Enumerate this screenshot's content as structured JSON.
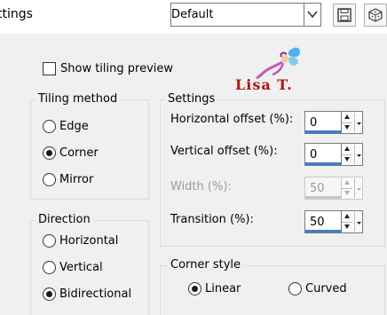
{
  "window": {
    "title": "ttings"
  },
  "preset": {
    "value": "Default"
  },
  "toolbar": {
    "save_icon": "save-icon",
    "random_icon": "dice-icon"
  },
  "show_tiling_preview": {
    "label": "Show tiling preview",
    "checked": false
  },
  "tiling_method": {
    "title": "Tiling method",
    "options": [
      {
        "label": "Edge",
        "checked": false
      },
      {
        "label": "Corner",
        "checked": true
      },
      {
        "label": "Mirror",
        "checked": false
      }
    ]
  },
  "direction": {
    "title": "Direction",
    "options": [
      {
        "label": "Horizontal",
        "checked": false
      },
      {
        "label": "Vertical",
        "checked": false
      },
      {
        "label": "Bidirectional",
        "checked": true
      }
    ]
  },
  "settings": {
    "title": "Settings",
    "horizontal_offset": {
      "label": "Horizontal offset (%):",
      "value": "0",
      "enabled": true
    },
    "vertical_offset": {
      "label": "Vertical offset (%):",
      "value": "0",
      "enabled": true
    },
    "width": {
      "label": "Width (%):",
      "value": "50",
      "enabled": false
    },
    "transition": {
      "label": "Transition (%):",
      "value": "50",
      "enabled": true
    }
  },
  "corner_style": {
    "title": "Corner style",
    "options": [
      {
        "label": "Linear",
        "checked": true
      },
      {
        "label": "Curved",
        "checked": false
      }
    ]
  },
  "watermark": {
    "text": "Lisa T."
  },
  "colors": {
    "accent": "#3c7fd0",
    "watermark": "#b5121b",
    "background": "#f0f0f0"
  }
}
